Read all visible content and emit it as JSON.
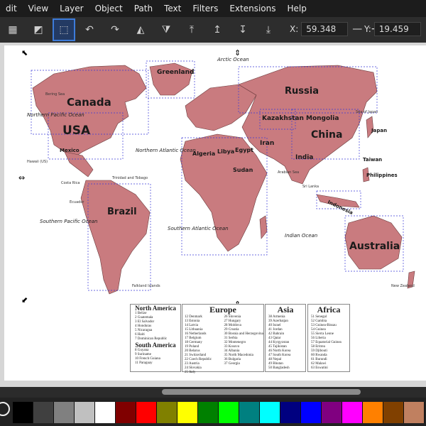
{
  "menubar": {
    "items": [
      "dit",
      "View",
      "Layer",
      "Object",
      "Path",
      "Text",
      "Filters",
      "Extensions",
      "Help"
    ]
  },
  "toolbar": {
    "tools": [
      "select-same-icon",
      "align-mask-icon",
      "select-all-icon",
      "rotate-ccw-icon",
      "rotate-cw-icon",
      "flip-horizontal-icon",
      "flip-vertical-icon",
      "raise-top-icon",
      "raise-icon",
      "lower-icon",
      "lower-bottom-icon"
    ],
    "x_label": "X:",
    "x_value": "59.348",
    "y_label": "Y:",
    "y_value": "19.459",
    "minus": "—",
    "plus": "+"
  },
  "map": {
    "countries": [
      "Greenland",
      "Canada",
      "USA",
      "Russia",
      "Kazakhstan",
      "Mongolia",
      "China",
      "Japan",
      "Iran",
      "India",
      "Brazil",
      "Australia",
      "Indonesia",
      "Taiwan",
      "Philippines",
      "Mexico",
      "Algeria",
      "Libya",
      "Egypt",
      "Sudan"
    ],
    "oceans": [
      "Northern Pacific Ocean",
      "Arctic Ocean",
      "Northern Atlantic Ocean",
      "Southern Atlantic Ocean",
      "Southern Pacific Ocean",
      "Indian Ocean"
    ],
    "small_labels": [
      "Bering Sea",
      "Hawaii (US)",
      "Costa Rica",
      "Ecuador",
      "Trinidad and Tobago",
      "Falkland Islands",
      "Arabian Sea",
      "Sri Lanka",
      "New Zealand",
      "Sea of Japan"
    ]
  },
  "legend": {
    "north_america": {
      "title": "North America",
      "items": [
        "1 Belize",
        "2 Guatemala",
        "3 El Salvador",
        "4 Honduras",
        "5 Nicaragua",
        "6 Haiti",
        "7 Dominican Republic"
      ]
    },
    "south_america": {
      "title": "South America",
      "items": [
        "8 Guyana",
        "9 Suriname",
        "10 French Guiana",
        "11 Paraguay"
      ]
    },
    "europe": {
      "title": "Europe",
      "col1": [
        "12 Denmark",
        "13 Estonia",
        "14 Latvia",
        "15 Lithuania",
        "16 Netherlands",
        "17 Belgium",
        "18 Germany",
        "19 Poland",
        "20 Belarus",
        "21 Switzerland",
        "22 Czech Republic",
        "23 Austria",
        "24 Slovakia",
        "25 Italy"
      ],
      "col2": [
        "26 Slovenia",
        "27 Hungary",
        "28 Moldova",
        "29 Croatia",
        "30 Bosnia and Herzegovina",
        "31 Serbia",
        "32 Montenegro",
        "33 Kosovo",
        "34 Albania",
        "35 North Macedonia",
        "36 Bulgaria",
        "37 Georgia"
      ]
    },
    "asia": {
      "title": "Asia",
      "items": [
        "38 Armenia",
        "39 Azerbaijan",
        "40 Israel",
        "41 Jordan",
        "42 Bahrain",
        "43 Qatar",
        "44 Kyrgyzstan",
        "45 Tajikistan",
        "46 North Korea",
        "47 South Korea",
        "48 Nepal",
        "49 Bhutan",
        "50 Bangladesh"
      ]
    },
    "africa": {
      "title": "Africa",
      "items": [
        "51 Senegal",
        "52 Gambia",
        "53 Guinea-Bissau",
        "54 Guinea",
        "55 Sierra Leone",
        "56 Liberia",
        "57 Equatorial Guinea",
        "58 Eritrea",
        "59 Djibouti",
        "60 Rwanda",
        "61 Burundi",
        "62 Malawi",
        "63 Eswatini"
      ]
    }
  },
  "colors": {
    "land": "#c97b7f",
    "land_stroke": "#6a3a3c",
    "selection": "#3b3bd8",
    "menubar_bg": "#1c1c1c",
    "toolbar_bg": "#2d2d2d",
    "canvas_bg": "#d6d6d6"
  },
  "palette": {
    "swatches": [
      "#000000",
      "#404040",
      "#808080",
      "#c0c0c0",
      "#ffffff",
      "#800000",
      "#ff0000",
      "#808000",
      "#ffff00",
      "#008000",
      "#00ff00",
      "#008080",
      "#00ffff",
      "#000080",
      "#0000ff",
      "#800080",
      "#ff00ff",
      "#ff8000",
      "#804000",
      "#c08060"
    ]
  }
}
